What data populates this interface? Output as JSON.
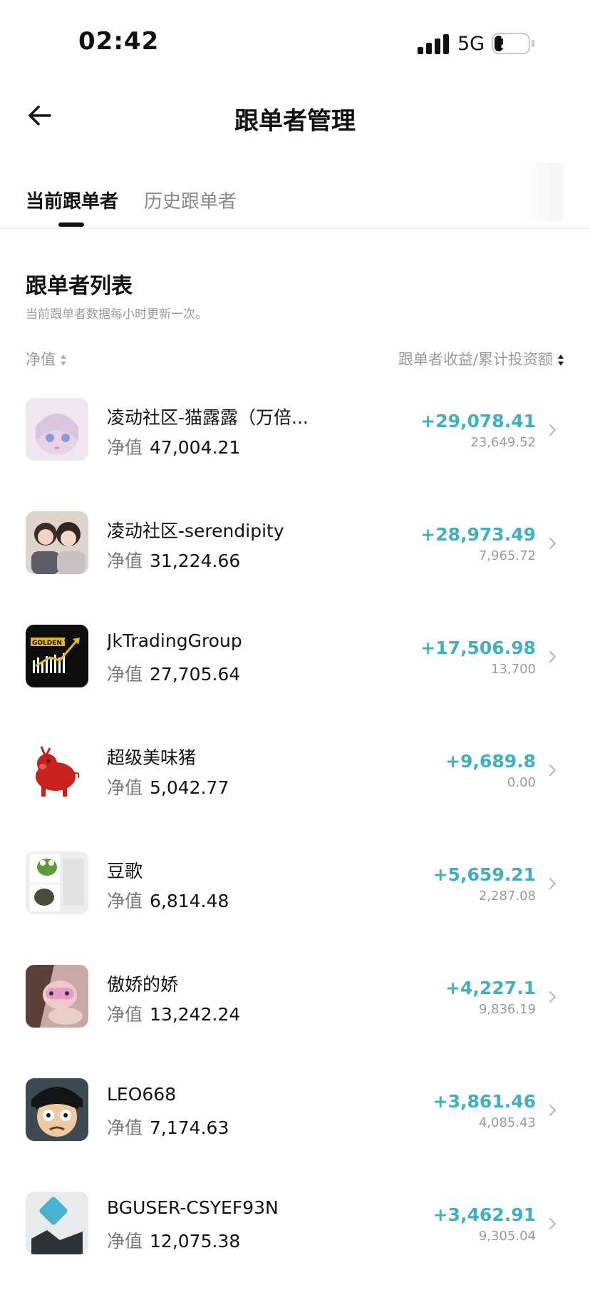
{
  "status_bar": {
    "time": "02:42",
    "network": "5G",
    "battery": "26"
  },
  "header": {
    "title": "跟单者管理",
    "back_icon": "arrow-left-icon"
  },
  "tabs": [
    {
      "label": "当前跟单者",
      "active": true
    },
    {
      "label": "历史跟单者",
      "active": false
    }
  ],
  "list": {
    "title": "跟单者列表",
    "subtitle": "当前跟单者数据每小时更新一次。",
    "col_left": "净值",
    "col_right": "跟单者收益/累计投资额",
    "equity_label": "净值",
    "items": [
      {
        "name": "凌动社区-猫露露（万倍...",
        "equity": "47,004.21",
        "profit": "+29,078.41",
        "invested": "23,649.52",
        "avatar": "anime-girl-avatar"
      },
      {
        "name": "凌动社区-serendipity",
        "equity": "31,224.66",
        "profit": "+28,973.49",
        "invested": "7,965.72",
        "avatar": "couple-photo-avatar"
      },
      {
        "name": "JkTradingGroup",
        "equity": "27,705.64",
        "profit": "+17,506.98",
        "invested": "13,700",
        "avatar": "golden-trade-logo-avatar",
        "avatar_text": "GOLDEN TRADE"
      },
      {
        "name": "超级美味猪",
        "equity": "5,042.77",
        "profit": "+9,689.8",
        "invested": "0.00",
        "avatar": "red-pig-avatar"
      },
      {
        "name": "豆歌",
        "equity": "6,814.48",
        "profit": "+5,659.21",
        "invested": "2,287.08",
        "avatar": "frog-meme-avatar"
      },
      {
        "name": "傲娇的娇",
        "equity": "13,242.24",
        "profit": "+4,227.1",
        "invested": "9,836.19",
        "avatar": "selfie-avatar"
      },
      {
        "name": "LEO668",
        "equity": "7,174.63",
        "profit": "+3,861.46",
        "invested": "4,085.43",
        "avatar": "cartoon-face-avatar"
      },
      {
        "name": "BGUSER-CSYEF93N",
        "equity": "12,075.38",
        "profit": "+3,462.91",
        "invested": "9,305.04",
        "avatar": "default-user-avatar"
      }
    ]
  },
  "colors": {
    "profit": "#3fb0c0",
    "muted": "#9a9a9a",
    "text": "#111111"
  }
}
